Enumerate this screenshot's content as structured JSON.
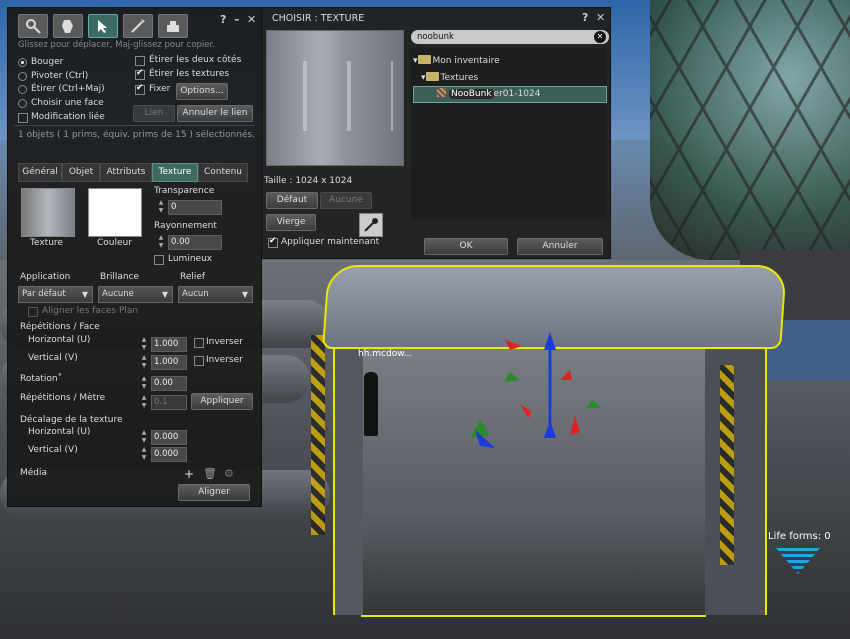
{
  "build": {
    "hint": "Glissez pour déplacer, Maj-glissez pour copier.",
    "tools": [
      "focus-icon",
      "move-icon",
      "edit-icon",
      "create-icon",
      "land-icon"
    ],
    "modes": [
      "Bouger",
      "Pivoter (Ctrl)",
      "Étirer (Ctrl+Maj)",
      "Choisir une face"
    ],
    "selected_mode": 0,
    "edit_linked": "Modification liée",
    "stretch_both": "Étirer les deux côtés",
    "stretch_textures": "Étirer les textures",
    "snap": "Fixer",
    "options": "Options...",
    "link": "Lien",
    "unlink": "Annuler le lien",
    "status": "1 objets ( 1 prims, équiv. prims de 15 ) sélectionnés.",
    "tabs": [
      "Général",
      "Objet",
      "Attributs",
      "Texture",
      "Contenu"
    ],
    "active_tab": "Texture",
    "texture_label": "Texture",
    "color_label": "Couleur",
    "transparency_label": "Transparence",
    "transparency_value": "0",
    "glow_label": "Rayonnement",
    "glow_value": "0.00",
    "fullbright_label": "Lumineux",
    "mapping_label": "Application",
    "mapping_value": "Par défaut",
    "shininess_label": "Brillance",
    "shininess_value": "Aucune",
    "bumpiness_label": "Relief",
    "bumpiness_value": "Aucun",
    "align_planar": "Aligner les faces Plan",
    "repeats_face_label": "Répétitions / Face",
    "horizontal_u": "Horizontal (U)",
    "horizontal_u_value": "1.000",
    "vertical_v": "Vertical (V)",
    "vertical_v_value": "1.000",
    "flip": "Inverser",
    "rotation_label": "Rotation˚",
    "rotation_value": "0.00",
    "repeats_meter_label": "Répétitions / Mètre",
    "repeats_meter_value": "0.1",
    "apply": "Appliquer",
    "offset_label": "Décalage de la texture",
    "offset_u_value": "0.000",
    "offset_v_value": "0.000",
    "media_label": "Média",
    "align": "Aligner"
  },
  "picker": {
    "title": "CHOISIR : TEXTURE",
    "size": "Taille : 1024 x 1024",
    "default": "Défaut",
    "none": "Aucune",
    "blank": "Vierge",
    "apply_now": "Appliquer maintenant",
    "search": "noobunk",
    "tree": {
      "root": "Mon inventaire",
      "folder": "Textures",
      "item_match": "NooBunk",
      "item_rest": "er01-1024"
    },
    "ok": "OK",
    "cancel": "Annuler"
  },
  "scene": {
    "avatar_name": "hh.mcdow...",
    "life_forms": "Life forms: 0"
  },
  "colors": {
    "accent": "#3d6b64",
    "selection": "#e8e800",
    "panel": "#1a1a1a"
  }
}
